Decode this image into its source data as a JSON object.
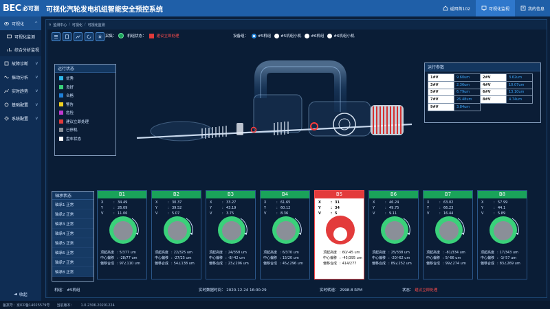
{
  "header": {
    "logo_text": "BEC",
    "logo_cn": "必可测",
    "title": "可视化汽轮发电机组智能安全预控系统",
    "buttons": [
      {
        "label": "返回首102",
        "icon": "home-icon"
      },
      {
        "label": "可视化监视",
        "icon": "monitor-icon"
      },
      {
        "label": "我的信息",
        "icon": "user-icon"
      }
    ]
  },
  "sidebar": {
    "items": [
      {
        "label": "可视化",
        "icon": "eye-icon",
        "chevron": "^"
      },
      {
        "label": "可视化监测",
        "icon": "monitor-icon",
        "sub": true
      },
      {
        "label": "综合分析监视",
        "icon": "chart-icon",
        "sub": true
      },
      {
        "label": "故障诊断",
        "icon": "diagnose-icon",
        "chevron": "v"
      },
      {
        "label": "振动分析",
        "icon": "wave-icon",
        "chevron": "v"
      },
      {
        "label": "实时趋势",
        "icon": "trend-icon",
        "chevron": "v"
      },
      {
        "label": "基础配置",
        "icon": "config-icon",
        "chevron": "v"
      },
      {
        "label": "系统配置",
        "icon": "gear-icon",
        "chevron": "v"
      }
    ],
    "collapse_label": "收起"
  },
  "footer": {
    "record": "备案号：京ICP备14025579号",
    "version_label": "当前版本：",
    "version": "1.0.2306.20201224"
  },
  "breadcrumb": [
    "监测中心",
    "可视化",
    "可视化监测"
  ],
  "controls": {
    "collect_label": "采集：",
    "state_label": "机组状态：",
    "state_text": "建议立即处理",
    "device_label": "设备组：",
    "devices": [
      "#5机组",
      "#5机组小机",
      "#6机组",
      "#6机组小机"
    ],
    "device_selected": 0
  },
  "legend": {
    "title": "运行状态",
    "items": [
      {
        "label": "优秀",
        "color": "#2fb7e8"
      },
      {
        "label": "良好",
        "color": "#3ad17a"
      },
      {
        "label": "合格",
        "color": "#1e7fd9"
      },
      {
        "label": "警告",
        "color": "#f0d020"
      },
      {
        "label": "危险",
        "color": "#c23ad1"
      },
      {
        "label": "建议立即处理",
        "color": "#e33b3b"
      },
      {
        "label": "已停机",
        "color": "#8a8f98"
      },
      {
        "label": "盘车状态",
        "color": "#ffffff"
      }
    ]
  },
  "params": {
    "title": "运行参数",
    "rows": [
      [
        {
          "k": "1#V",
          "v": "9.60um"
        },
        {
          "k": "2#V",
          "v": "3.62um"
        }
      ],
      [
        {
          "k": "3#V",
          "v": "2.36um"
        },
        {
          "k": "4#V",
          "v": "10.07um"
        }
      ],
      [
        {
          "k": "5#V",
          "v": "6.79um"
        },
        {
          "k": "6#V",
          "v": "13.10um"
        }
      ],
      [
        {
          "k": "7#V",
          "v": "26.48um"
        },
        {
          "k": "8#V",
          "v": "4.74um"
        }
      ],
      [
        {
          "k": "9#V",
          "v": "3.84um"
        },
        {
          "k": "",
          "v": ""
        }
      ]
    ]
  },
  "bearings": {
    "title": "轴承状态",
    "items": [
      "轴承1 正常",
      "轴承2 正常",
      "轴承3 正常",
      "轴承4 正常",
      "轴承5 正常",
      "轴承6 正常",
      "轴承7 正常",
      "轴承8 正常"
    ]
  },
  "cards": [
    {
      "name": "B1",
      "x": "34.49",
      "y": "26.09",
      "v": "11.06",
      "top": "5/377 um",
      "center": "-28/77 um",
      "sum": "97∠110 um",
      "alarm": false
    },
    {
      "name": "B2",
      "x": "30.37",
      "y": "39.52",
      "v": "5.07",
      "top": "22/325 um",
      "center": "-27/25 um",
      "sum": "54∠138 um",
      "alarm": false
    },
    {
      "name": "B3",
      "x": "33.27",
      "y": "43.19",
      "v": "3.75",
      "top": "24/358 um",
      "center": "-8/-42 um",
      "sum": "23∠206 um",
      "alarm": false
    },
    {
      "name": "B4",
      "x": "61.65",
      "y": "60.12",
      "v": "8.36",
      "top": "6/370 um",
      "center": "15/20 um",
      "sum": "45∠296 um",
      "alarm": false
    },
    {
      "name": "B5",
      "x": "31",
      "y": "34",
      "v": "5",
      "top": "60/-45 um",
      "center": "-45/395 um",
      "sum": "414/277",
      "alarm": true
    },
    {
      "name": "B6",
      "x": "46.24",
      "y": "49.75",
      "v": "9.11",
      "top": "25/338 um",
      "center": "-20/-62 um",
      "sum": "89∠252 um",
      "alarm": false
    },
    {
      "name": "B7",
      "x": "63.02",
      "y": "66.23",
      "v": "16.44",
      "top": "-81/334 um",
      "center": "5/-66 um",
      "sum": "99∠274 um",
      "alarm": false
    },
    {
      "name": "B8",
      "x": "57.99",
      "y": "44.1",
      "v": "5.89",
      "top": "17/343 um",
      "center": "-1/-57 um",
      "sum": "83∠269 um",
      "alarm": false
    }
  ],
  "card_labels": {
    "x": "X",
    "y": "Y",
    "v": "V",
    "colon": ":",
    "top": "顶起高度",
    "center": "中心偏移",
    "sum": "偏移合成"
  },
  "statusbar": {
    "unit_label": "机组：",
    "unit": "#5机组",
    "time_label": "实时数据时间：",
    "time": "2020-12-24 16:00:29",
    "speed_label": "实时转速：",
    "speed": "2998.8 RPM",
    "state_label": "状态：",
    "state": "建议立即处理"
  },
  "colors": {
    "header": "#1f5fa8",
    "normal": "#1aa35a",
    "alarm": "#e33b3b",
    "value": "#3aa8ff"
  }
}
